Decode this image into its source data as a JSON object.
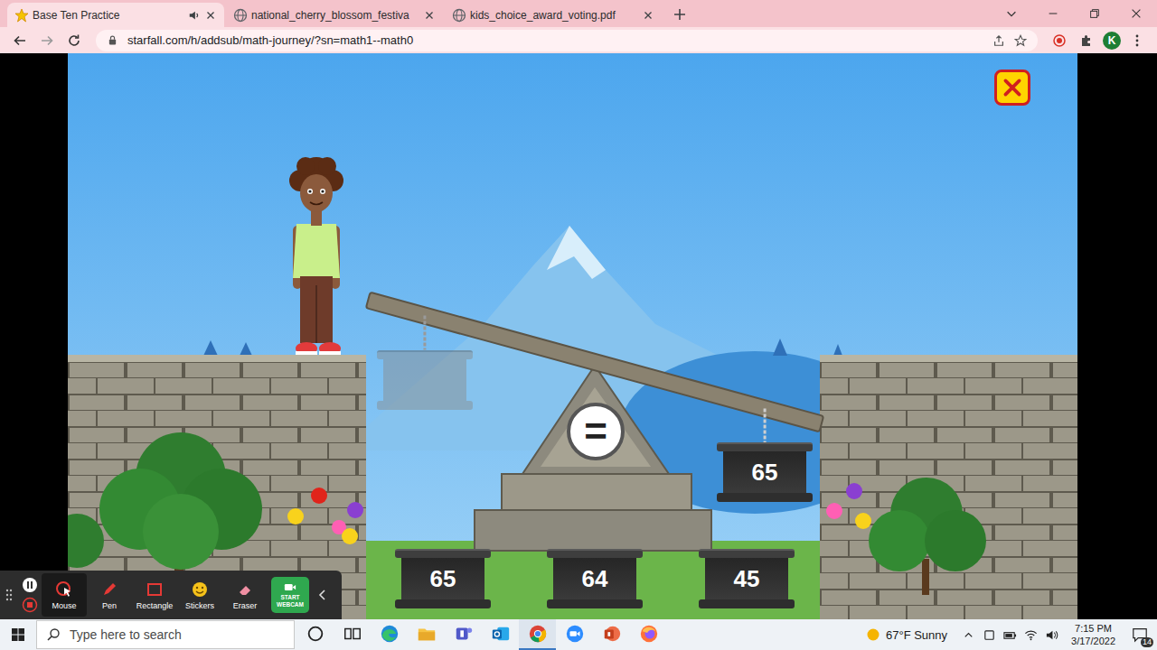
{
  "browser": {
    "tabs": [
      {
        "label": "Base Ten Practice",
        "selected": true,
        "audio": true,
        "kind": "starfall"
      },
      {
        "label": "national_cherry_blossom_festiva",
        "selected": false,
        "audio": false,
        "kind": "web"
      },
      {
        "label": "kids_choice_award_voting.pdf",
        "selected": false,
        "audio": false,
        "kind": "web"
      }
    ],
    "url": "starfall.com/h/addsub/math-journey/?sn=math1--math0",
    "profile": "K"
  },
  "game": {
    "balanced": false,
    "sign": "=",
    "left_weight": {
      "filled": false
    },
    "right_weight": "65",
    "choices": [
      {
        "value": "65"
      },
      {
        "value": "64"
      },
      {
        "value": "45"
      }
    ]
  },
  "recorder": {
    "paused": false,
    "tools": [
      {
        "label": "Mouse",
        "selected": true,
        "kind": "mouse"
      },
      {
        "label": "Pen",
        "selected": false,
        "kind": "pen"
      },
      {
        "label": "Rectangle",
        "selected": false,
        "kind": "rectangle"
      },
      {
        "label": "Stickers",
        "selected": false,
        "kind": "stickers"
      },
      {
        "label": "Eraser",
        "selected": false,
        "kind": "eraser"
      }
    ],
    "webcam_button": "START WEBCAM"
  },
  "taskbar": {
    "search_placeholder": "Type here to search",
    "apps": [
      {
        "kind": "cortana",
        "selected": false
      },
      {
        "kind": "taskview",
        "selected": false
      },
      {
        "kind": "edge",
        "selected": false
      },
      {
        "kind": "explorer",
        "selected": false
      },
      {
        "kind": "teams",
        "selected": false
      },
      {
        "kind": "outlook",
        "selected": false
      },
      {
        "kind": "chrome",
        "selected": true
      },
      {
        "kind": "zoom",
        "selected": false
      },
      {
        "kind": "powerpoint",
        "selected": false
      },
      {
        "kind": "firefox",
        "selected": false
      }
    ],
    "weather": "67°F Sunny",
    "time": "7:15 PM",
    "date": "3/17/2022",
    "notifications": "14"
  }
}
